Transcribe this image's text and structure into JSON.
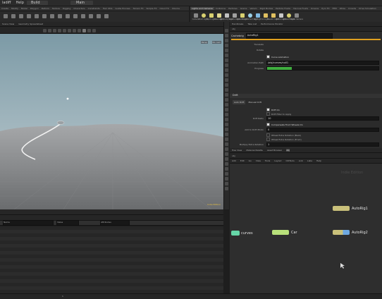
{
  "menubar": {
    "items": [
      "ladiff",
      "Help"
    ],
    "tabs": [
      "Build",
      "Main"
    ]
  },
  "shelf_tabs": [
    "Create",
    "Modify",
    "Model",
    "Polygon",
    "Deform",
    "Texture",
    "Rigging",
    "Characters",
    "Constraints",
    "Hair Utils",
    "Guide Process",
    "Terrain FX",
    "Simple FX",
    "Cloud FX",
    "Volume",
    "Lights and Cameras",
    "Collisions",
    "Particles",
    "Grains",
    "Vellum",
    "Rigid Bodies",
    "Particle Fluids",
    "Viscous Fluids",
    "Oceans",
    "Pyro FX",
    "FEM",
    "Wires",
    "Crowds",
    "Drive Simulation"
  ],
  "shelf_tools": [
    "Camera",
    "Point Light",
    "Spot Light",
    "Area Light",
    "Geometry Light",
    "Volume Light",
    "Distant Light",
    "Environment Light",
    "Sky Light",
    "GI Light",
    "Caustic Light",
    "Portal Light",
    "Ambient Light",
    "Stereo Camera"
  ],
  "viewport": {
    "tabs": [
      "Scene View",
      "Geometry Spreadsheet"
    ],
    "persp_label": "Persp",
    "cam_label": "No cam",
    "status_text": "Indie Edition"
  },
  "params": {
    "tabs": [
      "Handbrake",
      "Take List",
      "Performance Monitor"
    ],
    "path": "obj",
    "node_type": "Cachebrig",
    "node_name": "AutoRig1",
    "rows": [
      "Translate",
      "Rotate"
    ],
    "curve_animation_label": "Curve animation",
    "animation_path_label": "Animation Path",
    "animation_path_value": "/obj/curves/null1",
    "progress_label": "Progress",
    "progress_value": 0.22,
    "section_drift": "Drift",
    "subtabs": [
      "Auto Drift",
      "Manual Drift"
    ],
    "drift_on_label": "Drift On",
    "drift_filter_label": "Drift Filter to Apply",
    "drift_ratio_label": "Drift Ratio",
    "drift_ratio_value": "10",
    "compensate_label": "Compensate Front Wheels On",
    "add_to_drift_label": "Add to Drift Photo",
    "add_to_drift_value": "0",
    "wheel_extra_back_label": "Wheel Extra Rotation (Back)",
    "wheel_extra_front_label": "Wheel Extra Rotation (Front)",
    "multiply_label": "Multiply Extra Rotation",
    "multiply_value": "1"
  },
  "network": {
    "tabs": [
      "Tree View",
      "Material Palette",
      "Asset Browser",
      "obj"
    ],
    "path": "obj",
    "menu": [
      "Add",
      "Edit",
      "Go",
      "View",
      "Tools",
      "Layout",
      "OOTools",
      "ul-lk",
      "Labs",
      "Help"
    ],
    "watermark": "Indie Edition",
    "nodes": [
      {
        "name": "AutoRig1",
        "color": "#c9c07a"
      },
      {
        "name": "AutoRig2",
        "color": "#6ea8e0"
      },
      {
        "name": "curves",
        "color": "#66d6a8"
      },
      {
        "name": "Car",
        "color": "#b8e07a"
      }
    ]
  },
  "bottom": {
    "headers": [
      "Name",
      "Value",
      "Attributes"
    ],
    "frame_label": "1"
  }
}
